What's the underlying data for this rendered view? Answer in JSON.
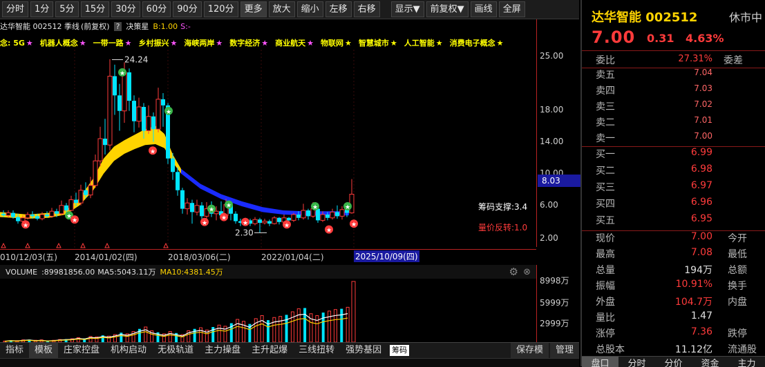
{
  "toolbar": {
    "buttons": [
      "分时",
      "1分",
      "5分",
      "15分",
      "30分",
      "60分",
      "90分",
      "120分",
      "更多",
      "放大",
      "缩小",
      "左移",
      "右移",
      "显示▼",
      "前复权▼",
      "画线",
      "全屏"
    ],
    "active": "季线"
  },
  "stock_info": {
    "name_code": "达华智能 002512 季线",
    "adjust": "(前复权)",
    "help": "?",
    "strategy_label": "决策星",
    "strategy_b": "B:1.00",
    "strategy_s": "S:-"
  },
  "concepts": {
    "prefix": "念: 5G",
    "items": [
      "机器人概念",
      "一带一路",
      "乡村振兴",
      "海峡两岸",
      "数字经济",
      "商业航天",
      "物联网",
      "智慧城市",
      "人工智能",
      "消费电子概念"
    ]
  },
  "price_axis": [
    "25.00",
    "18.00",
    "14.00",
    "10.00",
    "6.00",
    "2.00"
  ],
  "current_price_tag": "8.03",
  "annotations": {
    "high": "24.24",
    "low": "2.30",
    "support": "筹码支撑:3.4",
    "reversal": "量价反转:1.0"
  },
  "date_axis": [
    "010/12/03(五)",
    "2014/01/02(四)",
    "2018/03/06(二)",
    "2022/01/04(二)",
    "2025/10/09(四)"
  ],
  "volume": {
    "label": "VOLUME",
    "value": ":89981856.00",
    "ma5": "MA5:5043.11万",
    "ma10": "MA10:4381.45万",
    "axis": [
      "8998万",
      "5999万",
      "2999万"
    ]
  },
  "bottom_tabs": [
    "指标",
    "模板",
    "庄家控盘",
    "机构启动",
    "无极轨道",
    "主力操盘",
    "主升起爆",
    "三线扭转",
    "强势基因",
    "筹码",
    "保存模",
    "管理"
  ],
  "right_panel": {
    "title": "达华智能 002512",
    "status": "休市中",
    "price": "7.00",
    "change": "0.31",
    "change_pct": "4.63%",
    "weibi_label": "委比",
    "weibi_val": "27.31%",
    "weicha_label": "委差",
    "asks": [
      {
        "label": "卖五",
        "price": "7.04"
      },
      {
        "label": "卖四",
        "price": "7.03"
      },
      {
        "label": "卖三",
        "price": "7.02"
      },
      {
        "label": "卖二",
        "price": "7.01"
      },
      {
        "label": "卖一",
        "price": "7.00"
      }
    ],
    "bids": [
      {
        "label": "买一",
        "price": "6.99"
      },
      {
        "label": "买二",
        "price": "6.98"
      },
      {
        "label": "买三",
        "price": "6.97"
      },
      {
        "label": "买四",
        "price": "6.96"
      },
      {
        "label": "买五",
        "price": "6.95"
      }
    ],
    "stats": [
      {
        "label": "现价",
        "val": "7.00",
        "label2": "今开",
        "color": "#ff3b3b"
      },
      {
        "label": "最高",
        "val": "7.08",
        "label2": "最低",
        "color": "#ff3b3b"
      },
      {
        "label": "总量",
        "val": "194万",
        "label2": "总额",
        "color": "#e0e0e0"
      },
      {
        "label": "振幅",
        "val": "10.91%",
        "label2": "换手",
        "color": "#ff3b3b"
      },
      {
        "label": "外盘",
        "val": "104.7万",
        "label2": "内盘",
        "color": "#ff3b3b"
      },
      {
        "label": "量比",
        "val": "1.47",
        "label2": "",
        "color": "#e0e0e0"
      },
      {
        "label": "涨停",
        "val": "7.36",
        "label2": "跌停",
        "color": "#ff3b3b"
      },
      {
        "label": "总股本",
        "val": "11.12亿",
        "label2": "流通股",
        "color": "#e0e0e0"
      }
    ],
    "tabs": [
      "盘口",
      "分时",
      "分价",
      "资金",
      "主力"
    ]
  },
  "colors": {
    "up": "#ff3b3b",
    "down": "#00e5ff",
    "band_yellow": "#ffd400",
    "band_blue": "#1a2bff",
    "concept": "#ffff00"
  }
}
